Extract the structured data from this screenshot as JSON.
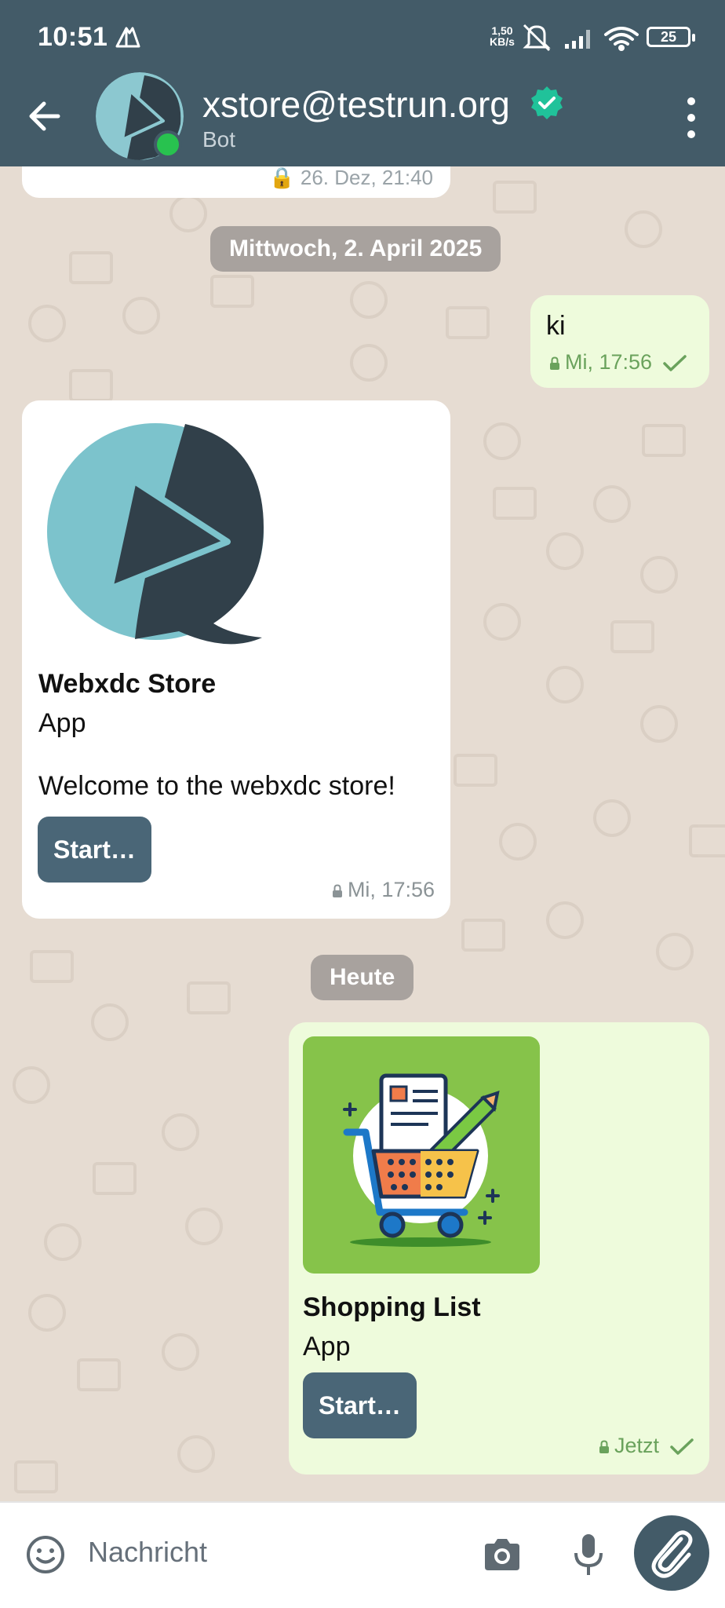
{
  "status_bar": {
    "time": "10:51",
    "speed_value": "1,50",
    "speed_unit": "KB/s",
    "battery": "25"
  },
  "header": {
    "title": "xstore@testrun.org",
    "subtitle": "Bot"
  },
  "chat": {
    "date_chips": [
      "Mittwoch, 2. April 2025",
      "Heute"
    ],
    "messages": [
      {
        "direction": "out",
        "text": "ki",
        "time": "Mi, 17:56"
      },
      {
        "direction": "in",
        "card_title": "Webxdc Store",
        "card_subtitle": "App",
        "text": "Welcome to the webxdc store!",
        "button": "Start…",
        "time": "Mi, 17:56"
      },
      {
        "direction": "out",
        "card_title": "Shopping List",
        "card_subtitle": "App",
        "button": "Start…",
        "time": "Jetzt"
      }
    ]
  },
  "composer": {
    "placeholder": "Nachricht"
  },
  "colors": {
    "header": "#435b68",
    "chat_bg": "#e6dcd2",
    "outgoing_bubble": "#eefbdc",
    "incoming_bubble": "#ffffff",
    "button": "#4a6677",
    "online": "#28c24f",
    "verified": "#20c29a"
  },
  "icons": [
    "back-arrow-icon",
    "verified-badge-icon",
    "more-vert-icon",
    "lock-icon",
    "checkmark-icon",
    "emoji-icon",
    "camera-icon",
    "microphone-icon",
    "paperclip-icon",
    "wifi-icon",
    "signal-icon",
    "mute-icon",
    "battery-icon"
  ]
}
